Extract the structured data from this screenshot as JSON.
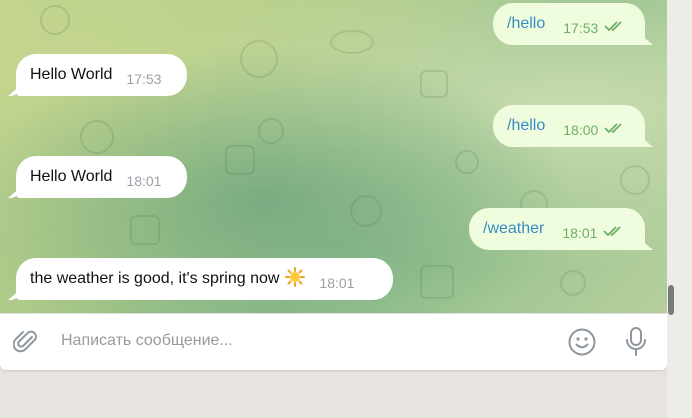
{
  "messages": [
    {
      "direction": "out",
      "text": "/hello",
      "time": "17:53",
      "is_command": true,
      "status": "read"
    },
    {
      "direction": "in",
      "text": "Hello World",
      "time": "17:53"
    },
    {
      "direction": "out",
      "text": "/hello",
      "time": "18:00",
      "is_command": true,
      "status": "read"
    },
    {
      "direction": "in",
      "text": "Hello World",
      "time": "18:01"
    },
    {
      "direction": "out",
      "text": "/weather",
      "time": "18:01",
      "is_command": true,
      "status": "read"
    },
    {
      "direction": "in",
      "text": "the weather is good, it's spring now",
      "emoji": "sun-emoji",
      "time": "18:01"
    }
  ],
  "composer": {
    "placeholder": "Написать сообщение...",
    "attach_icon": "paperclip-icon",
    "emoji_icon": "smiley-icon",
    "mic_icon": "microphone-icon"
  },
  "colors": {
    "incoming_bubble": "#ffffff",
    "outgoing_bubble": "#effdde",
    "command_link": "#3a8bc4",
    "read_check": "#6fae67",
    "time_in": "#9aa0a6"
  }
}
